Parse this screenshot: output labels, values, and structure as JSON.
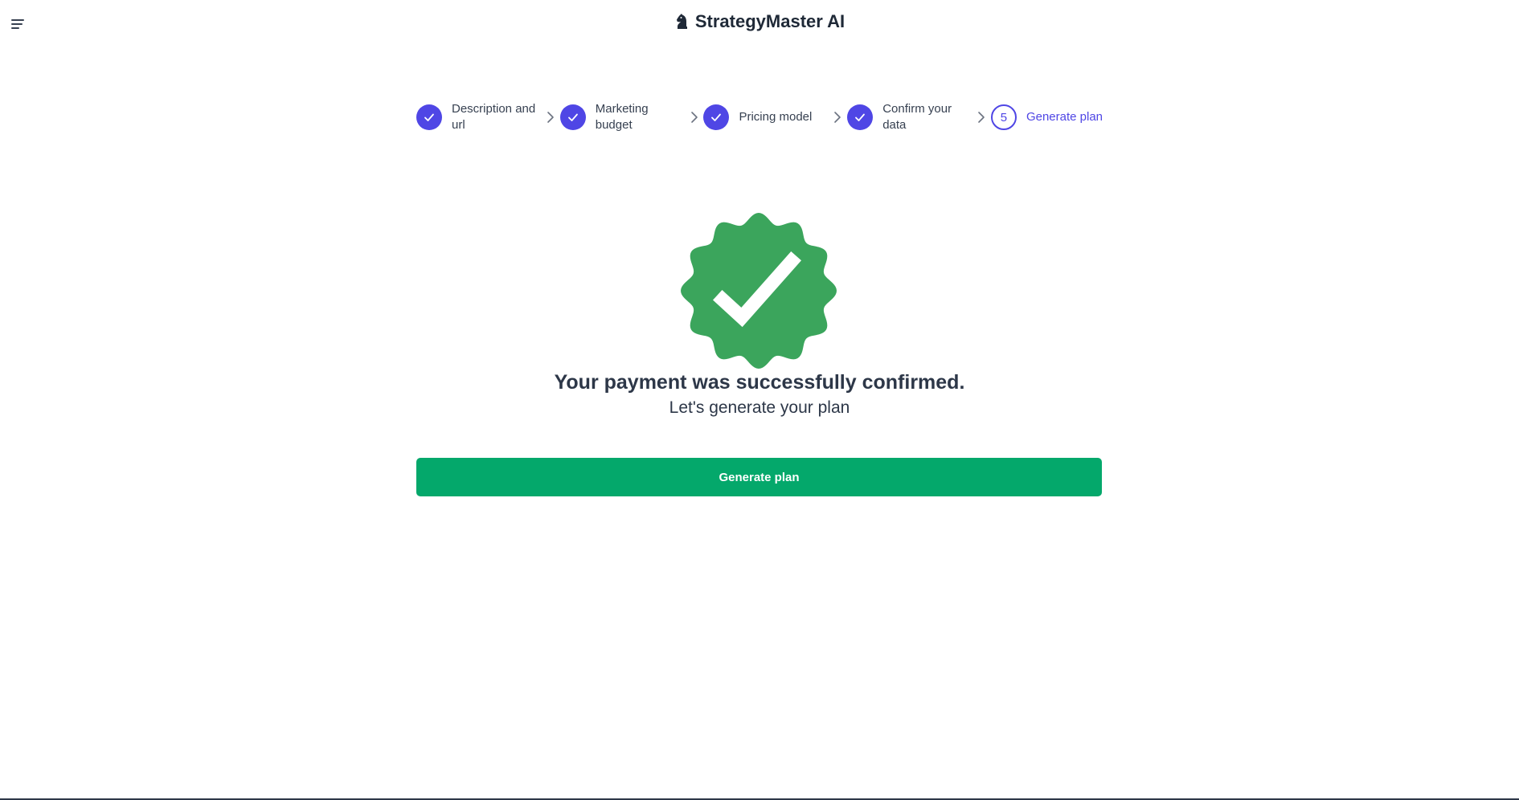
{
  "header": {
    "menu_icon": "menu-icon",
    "brand_icon": "chess-knight-icon",
    "title": "StrategyMaster AI"
  },
  "stepper": {
    "steps": [
      {
        "label": "Description and url",
        "status": "completed",
        "icon": "check-icon"
      },
      {
        "label": "Marketing budget",
        "status": "completed",
        "icon": "check-icon"
      },
      {
        "label": "Pricing model",
        "status": "completed",
        "icon": "check-icon"
      },
      {
        "label": "Confirm your data",
        "status": "completed",
        "icon": "check-icon"
      },
      {
        "label": "Generate plan",
        "status": "current",
        "number": "5"
      }
    ],
    "separator_icon": "chevron-right-icon"
  },
  "main": {
    "badge_icon": "verified-badge-icon",
    "headline": "Your payment was successfully confirmed.",
    "subline": "Let's generate your plan",
    "button_label": "Generate plan"
  },
  "colors": {
    "accent": "#4f46e5",
    "success_badge": "#3ba55c",
    "button": "#04a86b",
    "text": "#2d3748"
  }
}
